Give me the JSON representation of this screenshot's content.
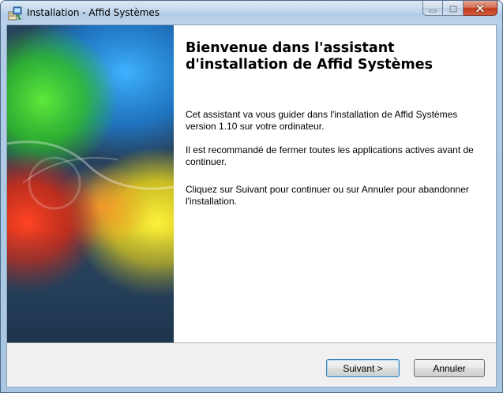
{
  "window": {
    "title": "Installation - Affid Systèmes",
    "minimize_icon": "minimize-icon",
    "maximize_icon": "maximize-icon",
    "close_icon": "close-icon",
    "app_icon": "installer-icon"
  },
  "wizard": {
    "heading": "Bienvenue dans l'assistant d'installation de Affid Systèmes",
    "paragraphs": [
      "Cet assistant va vous guider dans l'installation de Affid Systèmes version 1.10 sur votre ordinateur.",
      "Il est recommandé de fermer toutes les applications actives avant de continuer.",
      "Cliquez sur Suivant pour continuer ou sur Annuler pour abandonner l'installation."
    ]
  },
  "buttons": {
    "next_label": "Suivant >",
    "cancel_label": "Annuler"
  },
  "colors": {
    "close_button": "#c7432a",
    "titlebar": "#bcd3ea",
    "default_button_border": "#3c7fb1"
  }
}
